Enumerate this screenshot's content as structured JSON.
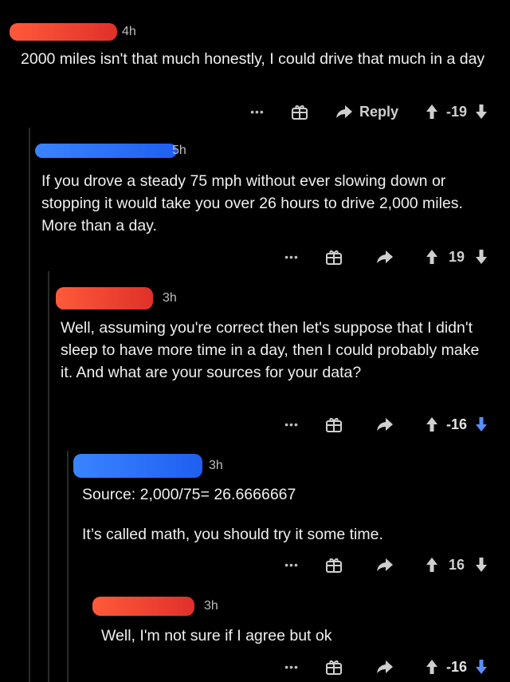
{
  "comments": [
    {
      "time": "4h",
      "redact_color": "#ff4a3a",
      "text": "2000 miles isn't that much honestly, I could drive that much in a day",
      "reply_label": "Reply",
      "score": "-19",
      "downvoted": false
    },
    {
      "time": "5h",
      "redact_color": "#2f7bff",
      "text": "If you drove a steady 75 mph without ever slowing down or stopping it would take you over 26 hours to drive 2,000 miles. More than a day.",
      "score": "19",
      "downvoted": false
    },
    {
      "time": "3h",
      "redact_color": "#ff4a3a",
      "text": "Well, assuming you're correct then let's suppose that I didn't sleep to have more time in a day, then I could probably make it. And what are your sources for your data?",
      "score": "-16",
      "downvoted": true
    },
    {
      "time": "3h",
      "redact_color": "#2f7bff",
      "text_line1": "Source: 2,000/75= 26.6666667",
      "text_line2": "It’s called math, you should try it some time.",
      "score": "16",
      "downvoted": false
    },
    {
      "time": "3h",
      "redact_color": "#ff4a3a",
      "text": "Well, I'm not sure if I agree but ok",
      "score": "-16",
      "downvoted": true
    }
  ],
  "icons": {
    "more": "dots-icon",
    "award": "gift-icon",
    "reply": "reply-arrow-icon",
    "upvote": "up-arrow-icon",
    "downvote": "down-arrow-icon"
  },
  "colors": {
    "background": "#000000",
    "downvote_active": "#5a8dff"
  }
}
